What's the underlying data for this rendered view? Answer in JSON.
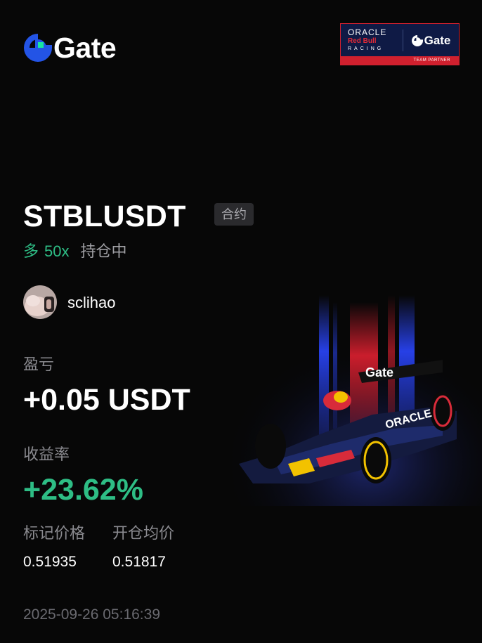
{
  "brand": {
    "name": "Gate",
    "logo_icon": "gate-logo-icon",
    "accent": "#2354e6",
    "accent2": "#17e6a1"
  },
  "partner": {
    "oracle": "ORACLE",
    "redbull": "Red Bull",
    "racing": "RACING",
    "gate": "Gate",
    "band": "TEAM PARTNER"
  },
  "position": {
    "pair": "STBLUSDT",
    "type_badge": "合约",
    "direction": "多",
    "leverage": "50x",
    "status": "持仓中",
    "direction_color": "#2ebd85"
  },
  "user": {
    "avatar_icon": "avatar",
    "name": "sclihao"
  },
  "pnl": {
    "label": "盈亏",
    "value": "+0.05 USDT"
  },
  "roi": {
    "label": "收益率",
    "value": "+23.62%"
  },
  "prices": {
    "mark_label": "标记价格",
    "mark_value": "0.51935",
    "entry_label": "开仓均价",
    "entry_value": "0.51817"
  },
  "timestamp": "2025-09-26 05:16:39",
  "car_livery": {
    "wing_text": "Gate",
    "sidepod_text": "ORACLE"
  }
}
